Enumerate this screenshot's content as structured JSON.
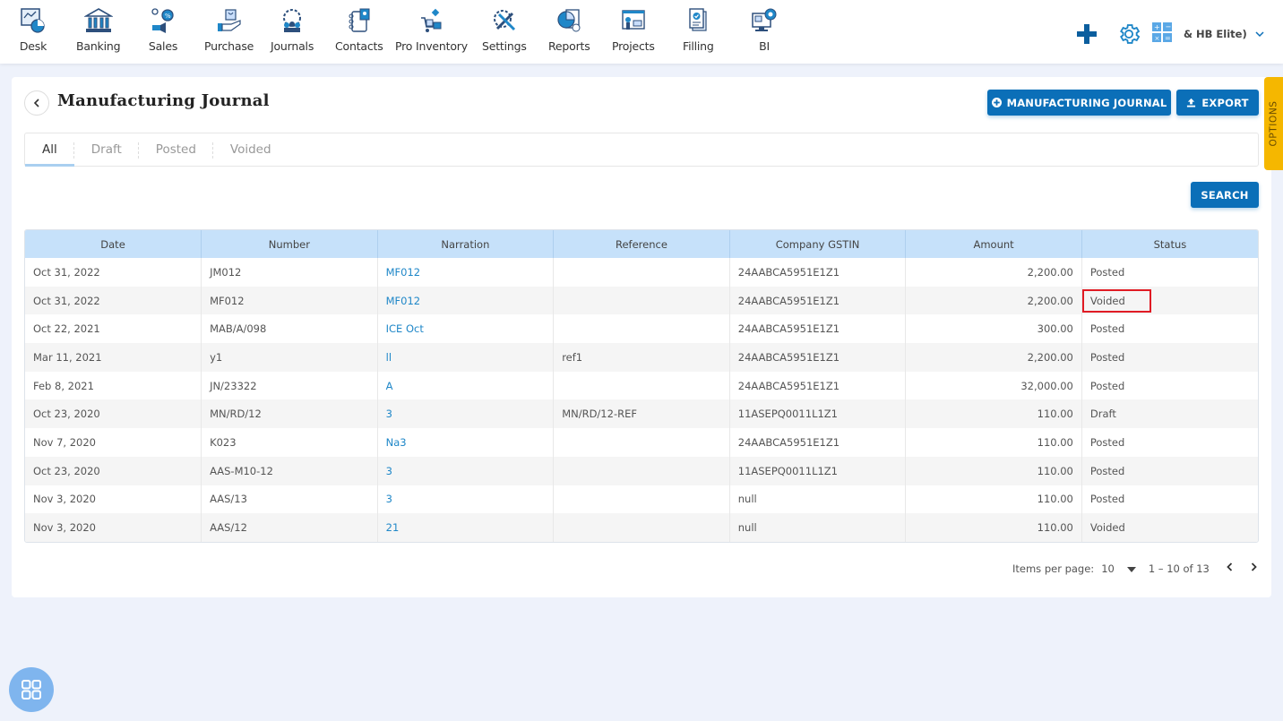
{
  "nav": {
    "items": [
      {
        "label": "Desk",
        "icon": "desk-icon"
      },
      {
        "label": "Banking",
        "icon": "bank-icon"
      },
      {
        "label": "Sales",
        "icon": "sales-icon"
      },
      {
        "label": "Purchase",
        "icon": "purchase-icon"
      },
      {
        "label": "Journals",
        "icon": "journals-icon"
      },
      {
        "label": "Contacts",
        "icon": "contacts-icon"
      },
      {
        "label": "Pro Inventory",
        "icon": "inventory-icon"
      },
      {
        "label": "Settings",
        "icon": "settings-tools-icon"
      },
      {
        "label": "Reports",
        "icon": "reports-icon"
      },
      {
        "label": "Projects",
        "icon": "projects-icon"
      },
      {
        "label": "Filling",
        "icon": "filling-icon"
      },
      {
        "label": "BI",
        "icon": "bi-icon"
      }
    ],
    "company": "& HB Elite)"
  },
  "page": {
    "title": "Manufacturing Journal",
    "add_button": "MANUFACTURING JOURNAL",
    "export_button": "EXPORT",
    "search_button": "SEARCH",
    "options_label": "OPTIONS"
  },
  "tabs": [
    {
      "label": "All",
      "active": true
    },
    {
      "label": "Draft",
      "active": false
    },
    {
      "label": "Posted",
      "active": false
    },
    {
      "label": "Voided",
      "active": false
    }
  ],
  "table": {
    "columns": [
      "Date",
      "Number",
      "Narration",
      "Reference",
      "Company GSTIN",
      "Amount",
      "Status"
    ],
    "rows": [
      {
        "date": "Oct 31, 2022",
        "number": "JM012",
        "narration": "MF012",
        "reference": "",
        "gstin": "24AABCA5951E1Z1",
        "amount": "2,200.00",
        "status": "Posted"
      },
      {
        "date": "Oct 31, 2022",
        "number": "MF012",
        "narration": "MF012",
        "reference": "",
        "gstin": "24AABCA5951E1Z1",
        "amount": "2,200.00",
        "status": "Voided",
        "highlighted": true
      },
      {
        "date": "Oct 22, 2021",
        "number": "MAB/A/098",
        "narration": "ICE Oct",
        "reference": "",
        "gstin": "24AABCA5951E1Z1",
        "amount": "300.00",
        "status": "Posted"
      },
      {
        "date": "Mar 11, 2021",
        "number": "y1",
        "narration": "ll",
        "reference": "ref1",
        "gstin": "24AABCA5951E1Z1",
        "amount": "2,200.00",
        "status": "Posted"
      },
      {
        "date": "Feb 8, 2021",
        "number": "JN/23322",
        "narration": "A",
        "reference": "",
        "gstin": "24AABCA5951E1Z1",
        "amount": "32,000.00",
        "status": "Posted"
      },
      {
        "date": "Oct 23, 2020",
        "number": "MN/RD/12",
        "narration": "3",
        "reference": "MN/RD/12-REF",
        "gstin": "11ASEPQ0011L1Z1",
        "amount": "110.00",
        "status": "Draft"
      },
      {
        "date": "Nov 7, 2020",
        "number": "K023",
        "narration": "Na3",
        "reference": "",
        "gstin": "24AABCA5951E1Z1",
        "amount": "110.00",
        "status": "Posted"
      },
      {
        "date": "Oct 23, 2020",
        "number": "AAS-M10-12",
        "narration": "3",
        "reference": "",
        "gstin": "11ASEPQ0011L1Z1",
        "amount": "110.00",
        "status": "Posted"
      },
      {
        "date": "Nov 3, 2020",
        "number": "AAS/13",
        "narration": "3",
        "reference": "",
        "gstin": "null",
        "amount": "110.00",
        "status": "Posted"
      },
      {
        "date": "Nov 3, 2020",
        "number": "AAS/12",
        "narration": "21",
        "reference": "",
        "gstin": "null",
        "amount": "110.00",
        "status": "Voided"
      }
    ]
  },
  "pagination": {
    "items_per_page_label": "Items per page:",
    "items_per_page": "10",
    "range": "1 – 10 of 13"
  },
  "colors": {
    "primary": "#0b6fb8",
    "header_bg": "#c6e1fa",
    "link": "#1f87c8",
    "options_tab": "#f5b700",
    "highlight": "#e01b24"
  }
}
